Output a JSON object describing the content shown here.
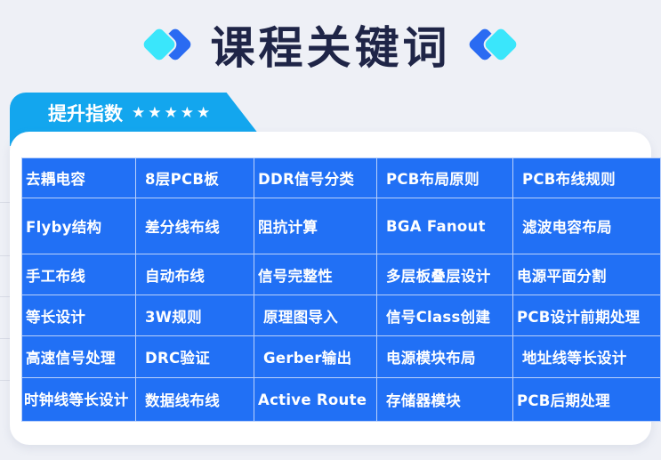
{
  "header": {
    "title": "课程关键词",
    "left_icon": "double-diamond-icon",
    "right_icon": "double-diamond-icon"
  },
  "section": {
    "tab_label": "提升指数",
    "rating": {
      "value": 5,
      "max": 5,
      "icon": "star-icon",
      "stars": "★★★★★"
    }
  },
  "colors": {
    "background": "#eef0f6",
    "title": "#1f2547",
    "tab": "#13a6ee",
    "cell": "#2170f5",
    "diamond_cyan": "#3ae6fb",
    "diamond_blue": "#2a6bf2"
  },
  "keywords": [
    [
      "去耦电容",
      "8层PCB板",
      "DDR信号分类",
      "PCB布局原则",
      "PCB布线规则"
    ],
    [
      "Flyby结构",
      "差分线布线",
      "阻抗计算",
      "BGA Fanout",
      "滤波电容布局"
    ],
    [
      "手工布线",
      "自动布线",
      "信号完整性",
      "多层板叠层设计",
      "电源平面分割"
    ],
    [
      "等长设计",
      "3W规则",
      "原理图导入",
      "信号Class创建",
      "PCB设计前期处理"
    ],
    [
      "高速信号处理",
      "DRC验证",
      "Gerber输出",
      "电源模块布局",
      "地址线等长设计"
    ],
    [
      "时钟线等长设计",
      "数据线布线",
      "Active Route",
      "存储器模块",
      "PCB后期处理"
    ]
  ]
}
